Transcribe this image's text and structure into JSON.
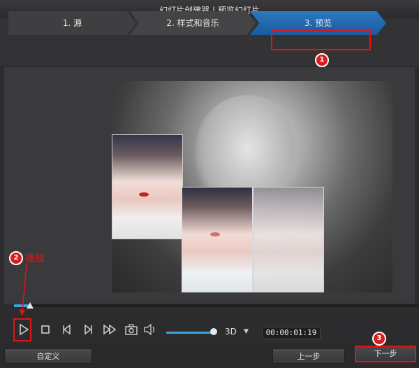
{
  "window": {
    "title": "幻灯片创建器 | 预览幻灯片"
  },
  "steps": [
    {
      "label": "1. 源"
    },
    {
      "label": "2. 样式和音乐"
    },
    {
      "label": "3. 预览",
      "active": true
    }
  ],
  "annotations": {
    "badge1": "1",
    "badge2": "2",
    "badge3": "3",
    "play_caption": "播放",
    "highlight_color": "#e01515"
  },
  "player": {
    "playback_progress": 0.04,
    "volume_level": 0.9,
    "mode_3d": "3D",
    "timecode": "00:00:01:19",
    "icons": [
      "play-icon",
      "stop-icon",
      "prev-frame-icon",
      "next-frame-icon",
      "fast-forward-icon",
      "camera-icon",
      "volume-icon"
    ]
  },
  "buttons": {
    "custom": "自定义",
    "prev": "上一步",
    "next": "下一步"
  },
  "colors": {
    "accent": "#3aa3e0",
    "step_active": "#1f63a8"
  }
}
